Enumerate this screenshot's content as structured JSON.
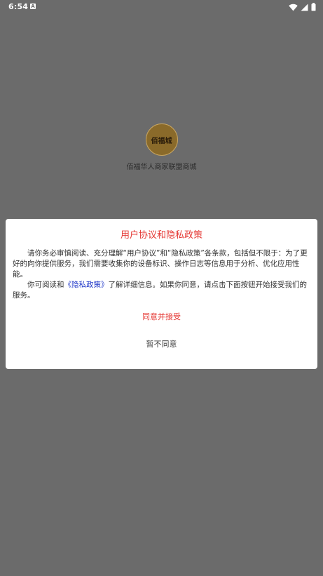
{
  "status_bar": {
    "time": "6:54",
    "notification_badge": "A",
    "icons": [
      "wifi-icon",
      "signal-icon",
      "battery-icon"
    ]
  },
  "splash": {
    "logo_text": "佰福城",
    "app_name": "佰福华人商家联盟商城"
  },
  "dialog": {
    "title": "用户协议和隐私政策",
    "paragraph1": "请你务必审慎阅读、充分理解“用户协议”和“隐私政策”各条款，包括但不限于：为了更好的向你提供服务，我们需要收集你的设备标识、操作日志等信息用于分析、优化应用性能。",
    "paragraph2_prefix": "你可阅读和",
    "policy_link": "《隐私政策》",
    "paragraph2_suffix": "了解详细信息。如果你同意，请点击下面按钮开始接受我们的服务。",
    "agree_label": "同意并接受",
    "decline_label": "暂不同意"
  },
  "colors": {
    "overlay": "#6b6b6b",
    "accent_red": "#e53935",
    "link_blue": "#1e36c8"
  }
}
